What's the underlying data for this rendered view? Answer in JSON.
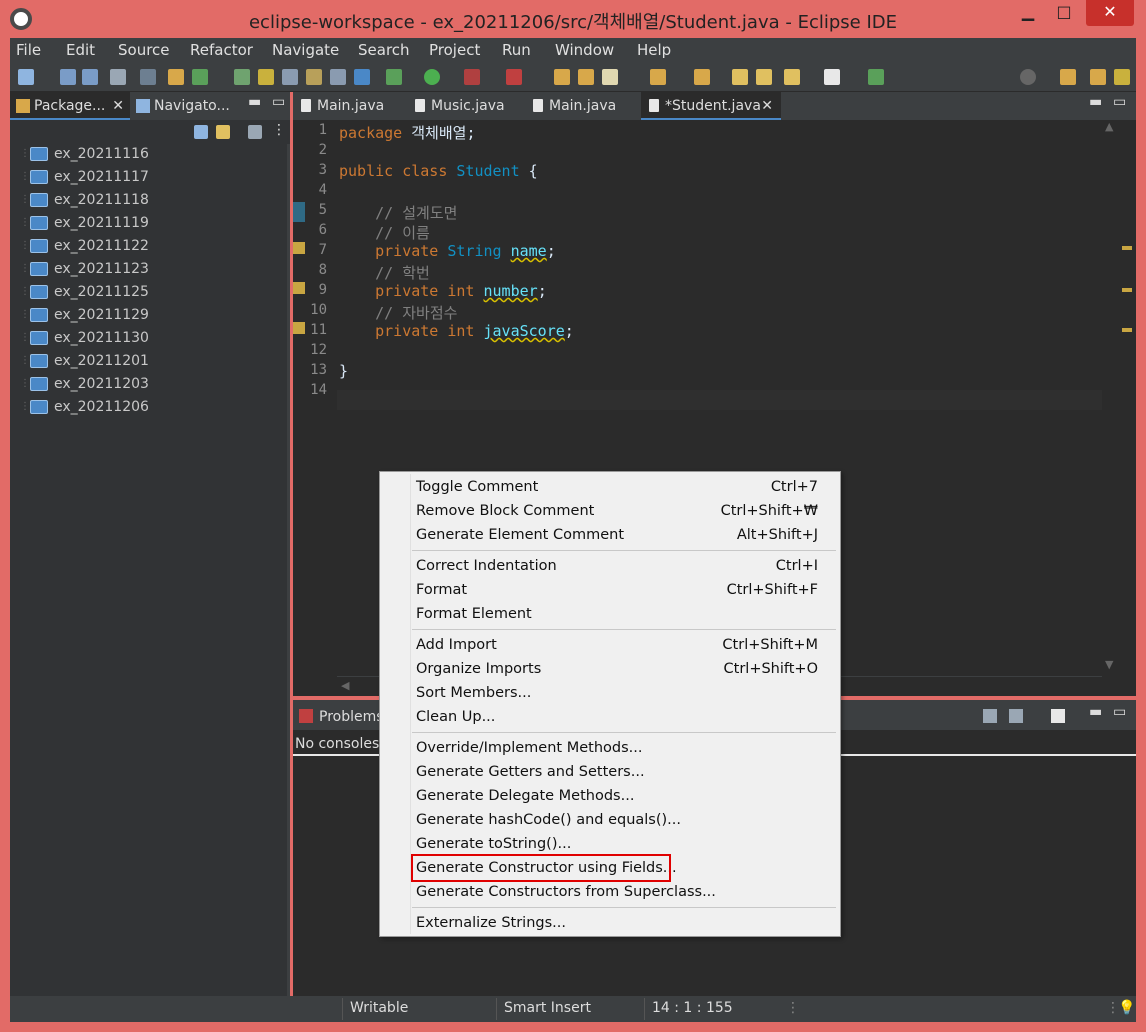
{
  "window": {
    "title": "eclipse-workspace - ex_20211206/src/객체배열/Student.java - Eclipse IDE",
    "min": "▁",
    "max": "□",
    "close": "✕"
  },
  "menubar": [
    "File",
    "Edit",
    "Source",
    "Refactor",
    "Navigate",
    "Search",
    "Project",
    "Run",
    "Window",
    "Help"
  ],
  "left_panel": {
    "tabs": [
      "Package...",
      "Navigato..."
    ],
    "projects": [
      "ex_20211116",
      "ex_20211117",
      "ex_20211118",
      "ex_20211119",
      "ex_20211122",
      "ex_20211123",
      "ex_20211125",
      "ex_20211129",
      "ex_20211130",
      "ex_20211201",
      "ex_20211203",
      "ex_20211206"
    ]
  },
  "editor": {
    "tabs": [
      "Main.java",
      "Music.java",
      "Main.java",
      "*Student.java"
    ],
    "line_numbers": [
      "1",
      "2",
      "3",
      "4",
      "5",
      "6",
      "7",
      "8",
      "9",
      "10",
      "11",
      "12",
      "13",
      "14"
    ],
    "code": {
      "l1_kw": "package",
      "l1_rest": " 객체배열;",
      "l3_kw1": "public",
      "l3_kw2": "class",
      "l3_cls": "Student",
      "l3_rest": " {",
      "l5": "    // 설계도면",
      "l6": "    // 이름",
      "l7_kw": "private",
      "l7_type": "String",
      "l7_fld": "name",
      "l8": "    // 학번",
      "l9_kw": "private",
      "l9_type": "int",
      "l9_fld": "number",
      "l10": "    // 자바점수",
      "l11_kw": "private",
      "l11_type": "int",
      "l11_fld": "javaScore",
      "l13": "}"
    }
  },
  "bottom_panel": {
    "tab": "Problems",
    "status": "No consoles"
  },
  "statusbar": {
    "writable": "Writable",
    "insert": "Smart Insert",
    "position": "14 : 1 : 155"
  },
  "context_menu": {
    "groups": [
      [
        {
          "label": "Toggle Comment",
          "shortcut": "Ctrl+7"
        },
        {
          "label": "Remove Block Comment",
          "shortcut": "Ctrl+Shift+₩"
        },
        {
          "label": "Generate Element Comment",
          "shortcut": "Alt+Shift+J"
        }
      ],
      [
        {
          "label": "Correct Indentation",
          "shortcut": "Ctrl+I"
        },
        {
          "label": "Format",
          "shortcut": "Ctrl+Shift+F"
        },
        {
          "label": "Format Element",
          "shortcut": ""
        }
      ],
      [
        {
          "label": "Add Import",
          "shortcut": "Ctrl+Shift+M"
        },
        {
          "label": "Organize Imports",
          "shortcut": "Ctrl+Shift+O"
        },
        {
          "label": "Sort Members...",
          "shortcut": ""
        },
        {
          "label": "Clean Up...",
          "shortcut": ""
        }
      ],
      [
        {
          "label": "Override/Implement Methods...",
          "shortcut": ""
        },
        {
          "label": "Generate Getters and Setters...",
          "shortcut": ""
        },
        {
          "label": "Generate Delegate Methods...",
          "shortcut": ""
        },
        {
          "label": "Generate hashCode() and equals()...",
          "shortcut": ""
        },
        {
          "label": "Generate toString()...",
          "shortcut": ""
        },
        {
          "label": "Generate Constructor using Fields...",
          "shortcut": ""
        },
        {
          "label": "Generate Constructors from Superclass...",
          "shortcut": ""
        }
      ],
      [
        {
          "label": "Externalize Strings...",
          "shortcut": ""
        }
      ]
    ]
  },
  "colors": {
    "frame": "#e26b67",
    "background": "#2b2b2b",
    "keyword": "#cc7832",
    "type": "#1290c3",
    "field": "#66e1f8",
    "highlight_box": "#e00000"
  }
}
